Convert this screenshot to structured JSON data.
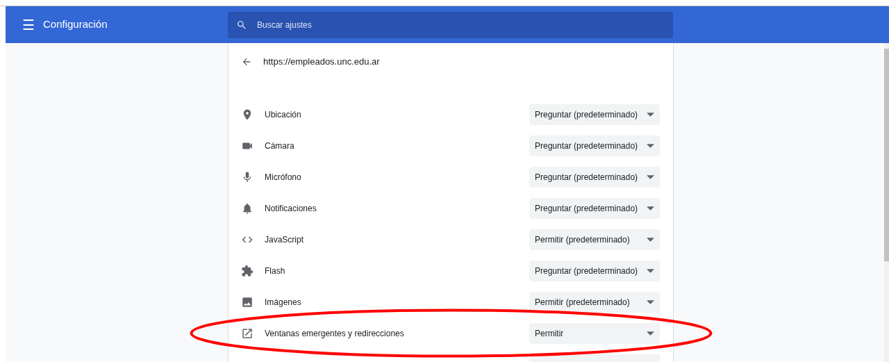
{
  "header": {
    "title": "Configuración",
    "menu_glyph": "☰"
  },
  "search": {
    "placeholder": "Buscar ajustes"
  },
  "site": {
    "url": "https://empleados.unc.edu.ar"
  },
  "permissions": [
    {
      "kind": "location",
      "label": "Ubicación",
      "value": "Preguntar (predeterminado)"
    },
    {
      "kind": "camera",
      "label": "Cámara",
      "value": "Preguntar (predeterminado)"
    },
    {
      "kind": "microphone",
      "label": "Micrófono",
      "value": "Preguntar (predeterminado)"
    },
    {
      "kind": "notifications",
      "label": "Notificaciones",
      "value": "Preguntar (predeterminado)"
    },
    {
      "kind": "code",
      "label": "JavaScript",
      "value": "Permitir (predeterminado)"
    },
    {
      "kind": "puzzle",
      "label": "Flash",
      "value": "Preguntar (predeterminado)"
    },
    {
      "kind": "image",
      "label": "Imágenes",
      "value": "Permitir (predeterminado)"
    },
    {
      "kind": "popup",
      "label": "Ventanas emergentes y redirecciones",
      "value": "Permitir",
      "highlighted": true
    }
  ]
}
